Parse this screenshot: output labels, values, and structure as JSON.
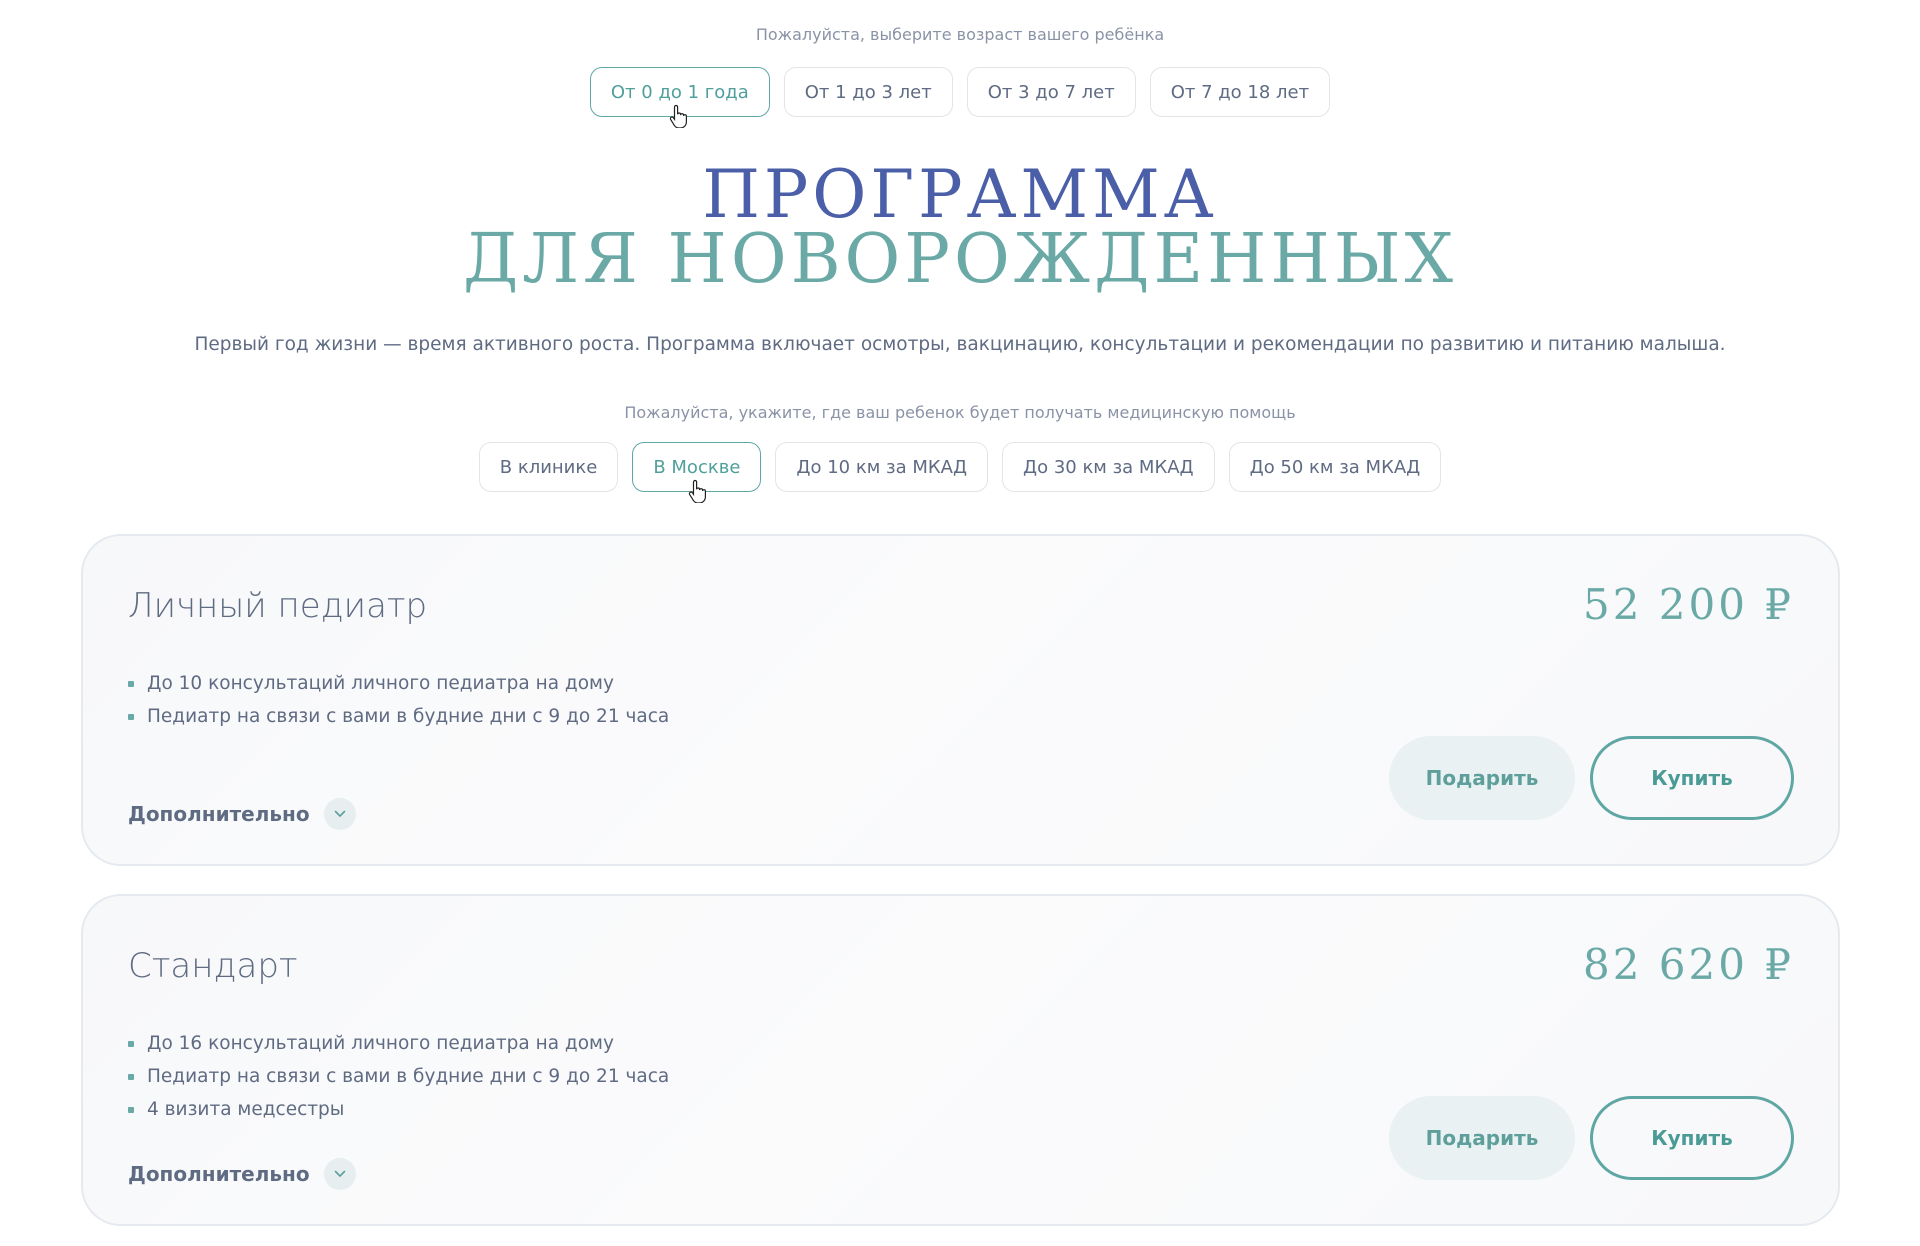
{
  "age_selector": {
    "hint": "Пожалуйста, выберите возраст вашего ребёнка",
    "options": [
      "От 0 до 1 года",
      "От 1 до 3 лет",
      "От 3 до 7 лет",
      "От 7 до 18 лет"
    ],
    "selected_index": 0
  },
  "program": {
    "title_line1": "ПРОГРАММА",
    "title_line2": "ДЛЯ НОВОРОЖДЕННЫХ",
    "description": "Первый год жизни — время активного роста. Программа включает осмотры, вакцинацию, консультации и рекомендации по развитию и питанию малыша."
  },
  "location_selector": {
    "hint": "Пожалуйста, укажите, где ваш ребенок будет получать медицинскую помощь",
    "options": [
      "В клинике",
      "В Москве",
      "До 10 км за МКАД",
      "До 30 км за МКАД",
      "До 50 км за МКАД"
    ],
    "selected_index": 1
  },
  "plans": [
    {
      "name": "Личный педиатр",
      "price": "52 200 ₽",
      "features": [
        "До 10 консультаций личного педиатра на дому",
        "Педиатр на связи с вами в будние дни с 9 до 21 часа"
      ],
      "more_label": "Дополнительно",
      "gift_label": "Подарить",
      "buy_label": "Купить"
    },
    {
      "name": "Стандарт",
      "price": "82 620 ₽",
      "features": [
        "До 16 консультаций личного педиатра на дому",
        "Педиатр на связи с вами в будние дни с 9 до 21 часа",
        "4 визита медсестры"
      ],
      "more_label": "Дополнительно",
      "gift_label": "Подарить",
      "buy_label": "Купить"
    }
  ],
  "colors": {
    "accent_teal": "#5fa7a4",
    "title_blue": "#4a5fa8",
    "text_gray": "#5f6b82"
  },
  "icons": {
    "cursor": "hand-pointer-icon",
    "expand": "chevron-down-icon",
    "bullet": "square-bullet"
  }
}
